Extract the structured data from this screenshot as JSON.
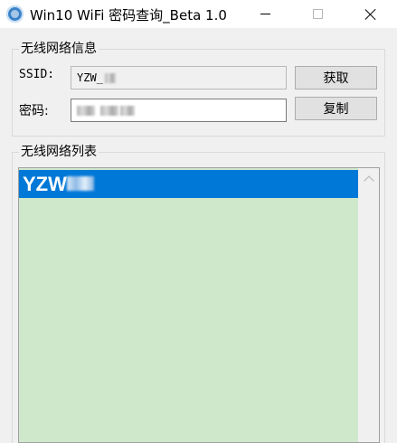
{
  "window": {
    "title": "Win10 WiFi 密码查询_Beta 1.0",
    "app_icon": "wifi-app-icon"
  },
  "wifi_info": {
    "group_title": "无线网络信息",
    "ssid_label": "SSID:",
    "ssid_value": "YZW_",
    "password_label": "密码:",
    "get_button": "获取",
    "copy_button": "复制"
  },
  "wifi_list": {
    "group_title": "无线网络列表",
    "items": [
      {
        "label": "YZW",
        "selected": true
      }
    ]
  },
  "colors": {
    "selection": "#0078d7",
    "list_background": "#cfe8cc",
    "window_background": "#f0f0f0"
  }
}
